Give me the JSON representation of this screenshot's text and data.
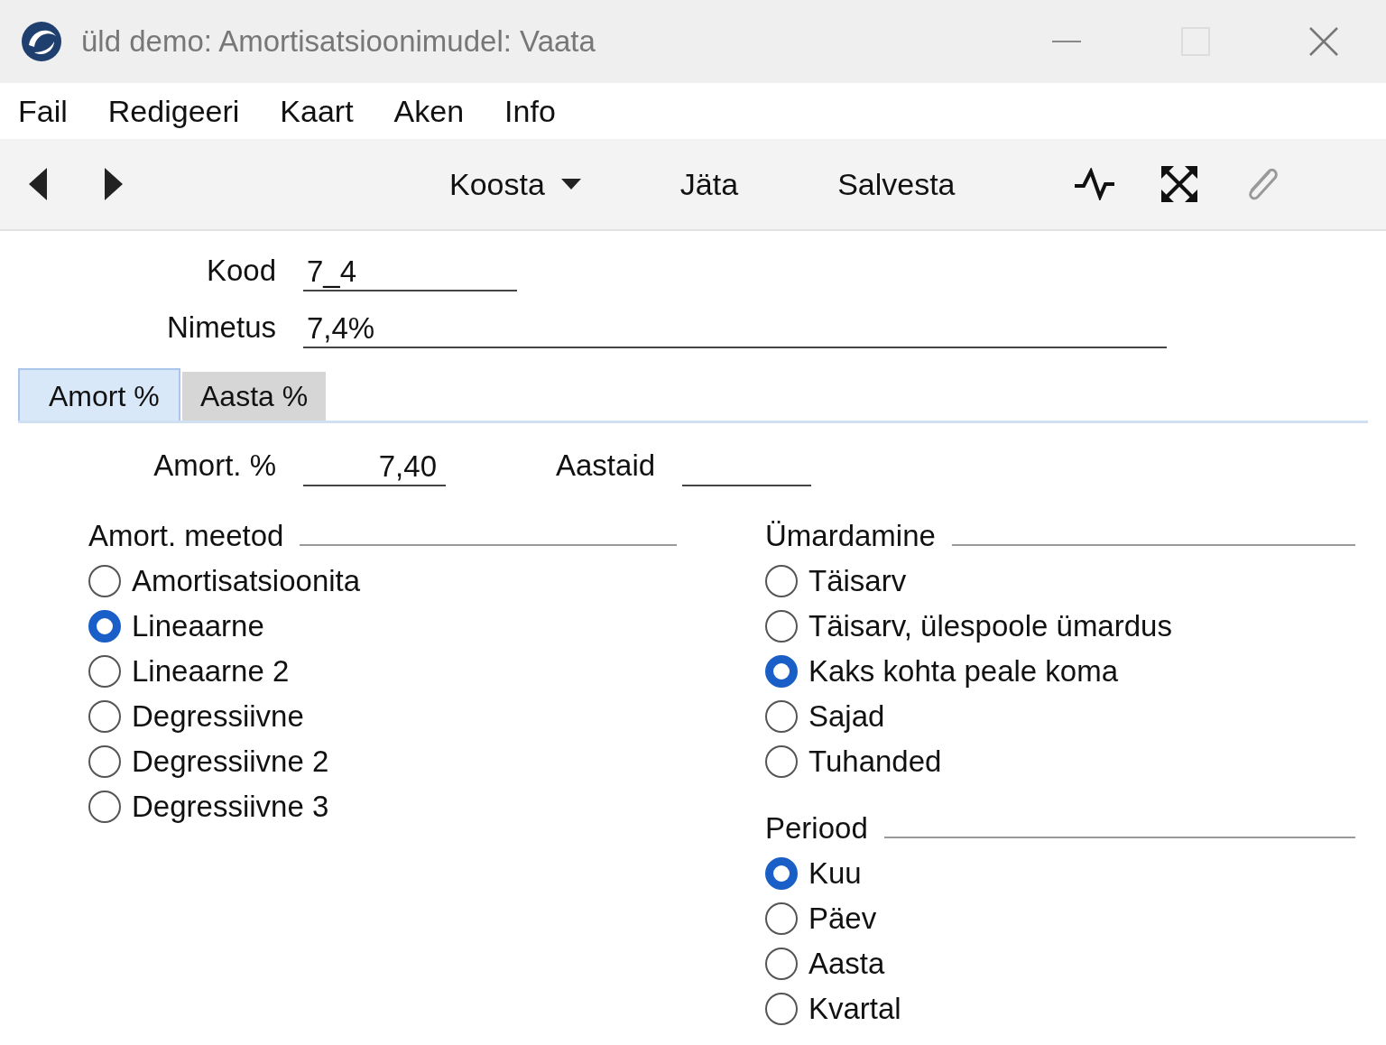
{
  "window": {
    "title": "üld demo: Amortisatsioonimudel: Vaata"
  },
  "menu": [
    "Fail",
    "Redigeeri",
    "Kaart",
    "Aken",
    "Info"
  ],
  "toolbar": {
    "buttons": [
      {
        "label": "Koosta",
        "kind": "dropdown"
      },
      {
        "label": "Jäta",
        "kind": "plain"
      },
      {
        "label": "Salvesta",
        "kind": "plain"
      }
    ]
  },
  "fields": [
    {
      "label": "Kood",
      "value": "7_4",
      "kind": "short"
    },
    {
      "label": "Nimetus",
      "value": "7,4%",
      "kind": "long"
    }
  ],
  "tabs": [
    {
      "label": "Amort %",
      "selected": true
    },
    {
      "label": "Aasta %",
      "selected": false
    }
  ],
  "amort_fields": [
    {
      "label": "Amort. %",
      "value": "7,40"
    },
    {
      "label": "Aastaid"
    }
  ],
  "left_groups": [
    {
      "title": "Amort. meetod",
      "options": [
        {
          "label": "Amortisatsioonita",
          "selected": false
        },
        {
          "label": "Lineaarne",
          "selected": true
        },
        {
          "label": "Lineaarne 2",
          "selected": false
        },
        {
          "label": "Degressiivne",
          "selected": false
        },
        {
          "label": "Degressiivne 2",
          "selected": false
        },
        {
          "label": "Degressiivne 3",
          "selected": false
        }
      ]
    }
  ],
  "right_groups": [
    {
      "title": "Ümardamine",
      "options": [
        {
          "label": "Täisarv",
          "selected": false
        },
        {
          "label": "Täisarv, ülespoole ümardus",
          "selected": false
        },
        {
          "label": "Kaks kohta peale koma",
          "selected": true
        },
        {
          "label": "Sajad",
          "selected": false
        },
        {
          "label": "Tuhanded",
          "selected": false
        }
      ]
    },
    {
      "title": "Periood",
      "options": [
        {
          "label": "Kuu",
          "selected": true
        },
        {
          "label": "Päev",
          "selected": false
        },
        {
          "label": "Aasta",
          "selected": false
        },
        {
          "label": "Kvartal",
          "selected": false
        }
      ]
    }
  ]
}
